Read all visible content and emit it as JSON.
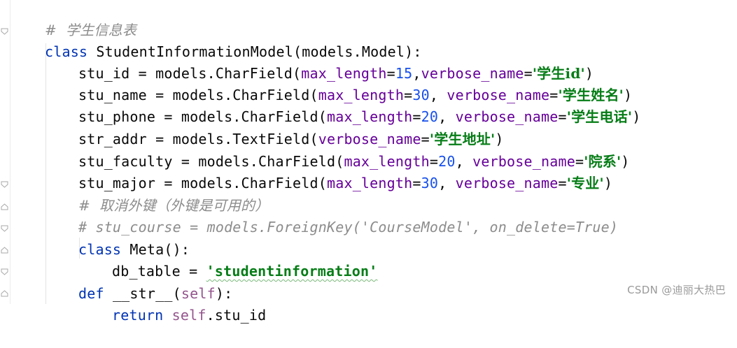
{
  "editor": {
    "lines": [
      {
        "comment": "#  学生信息表"
      },
      {
        "kw": "class",
        "name": " StudentInformationModel(models.Model):"
      },
      {
        "field": "stu_id = models.CharField(",
        "p1": "max_length",
        "v1": "15",
        "sep": ",",
        "p2": "verbose_name",
        "s": "'学生id'",
        "end": ")"
      },
      {
        "field": "stu_name = models.CharField(",
        "p1": "max_length",
        "v1": "30",
        "sep": ", ",
        "p2": "verbose_name",
        "s": "'学生姓名'",
        "end": ")"
      },
      {
        "field": "stu_phone = models.CharField(",
        "p1": "max_length",
        "v1": "20",
        "sep": ", ",
        "p2": "verbose_name",
        "s": "'学生电话'",
        "end": ")"
      },
      {
        "field": "str_addr = models.TextField(",
        "p2": "verbose_name",
        "s": "'学生地址'",
        "end": ")"
      },
      {
        "field": "stu_faculty = models.CharField(",
        "p1": "max_length",
        "v1": "20",
        "sep": ", ",
        "p2": "verbose_name",
        "s": "'院系'",
        "end": ")"
      },
      {
        "field": "stu_major = models.CharField(",
        "p1": "max_length",
        "v1": "30",
        "sep": ", ",
        "p2": "verbose_name",
        "s": "'专业'",
        "end": ")"
      },
      {
        "comment": "#  取消外键（外键是可用的）"
      },
      {
        "comment": "# stu_course = models.ForeignKey('CourseModel', on_delete=True)"
      },
      {
        "kw": "class",
        "name": " Meta():"
      },
      {
        "plain": "db_table = ",
        "s": "'studentinformation'"
      },
      {
        "kw": "def",
        "name": " __str__(",
        "self": "self",
        "end": "):"
      },
      {
        "kw": "return",
        "self": "self",
        "name": ".stu_id"
      }
    ]
  },
  "watermark": "CSDN @迪丽大热巴",
  "colors": {
    "keyword": "#0033b3",
    "comment": "#8c8c8c",
    "string": "#067d17",
    "param": "#660099",
    "number": "#1750eb",
    "self": "#94558d"
  }
}
